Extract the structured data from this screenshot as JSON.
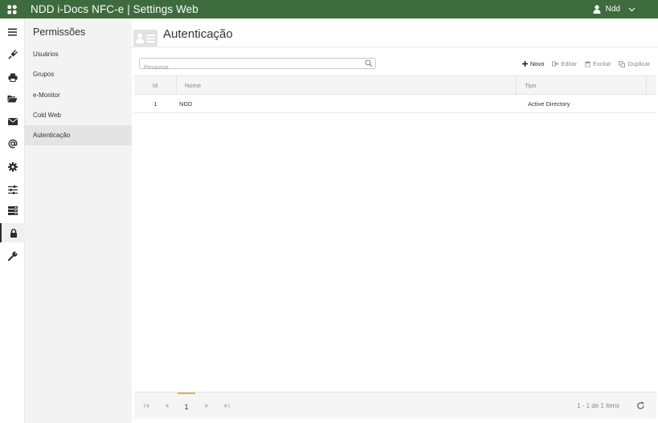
{
  "app": {
    "title": "NDD i-Docs NFC-e | Settings Web",
    "user": "Ndd"
  },
  "colors": {
    "topbar": "#3d6b3d",
    "accent": "#e8b24c"
  },
  "rail": {
    "items": [
      {
        "icon": "menu-icon"
      },
      {
        "icon": "plug-icon"
      },
      {
        "icon": "printer-icon"
      },
      {
        "icon": "folder-open-icon"
      },
      {
        "icon": "envelope-icon"
      },
      {
        "icon": "at-icon"
      },
      {
        "icon": "gear-icon"
      },
      {
        "icon": "sliders-icon"
      },
      {
        "icon": "server-icon"
      },
      {
        "icon": "lock-icon",
        "active": true
      },
      {
        "icon": "wrench-icon"
      }
    ]
  },
  "submenu": {
    "heading": "Permissões",
    "items": [
      {
        "label": "Usuários"
      },
      {
        "label": "Grupos"
      },
      {
        "label": "e-Monitor"
      },
      {
        "label": "Cold Web"
      },
      {
        "label": "Autenticação",
        "active": true
      }
    ]
  },
  "page": {
    "title": "Autenticação",
    "search_placeholder": "Pesquisar",
    "search_value": ""
  },
  "toolbar": {
    "new_label": "Novo",
    "edit_label": "Editar",
    "delete_label": "Excluir",
    "duplicate_label": "Duplicar"
  },
  "table": {
    "columns": [
      "Id",
      "Nome",
      "Tipo"
    ],
    "rows": [
      {
        "id": "1",
        "nome": "NDD",
        "tipo": "Active Directory"
      }
    ]
  },
  "pager": {
    "current_page": "1",
    "info": "1 - 1 de 1 itens"
  }
}
